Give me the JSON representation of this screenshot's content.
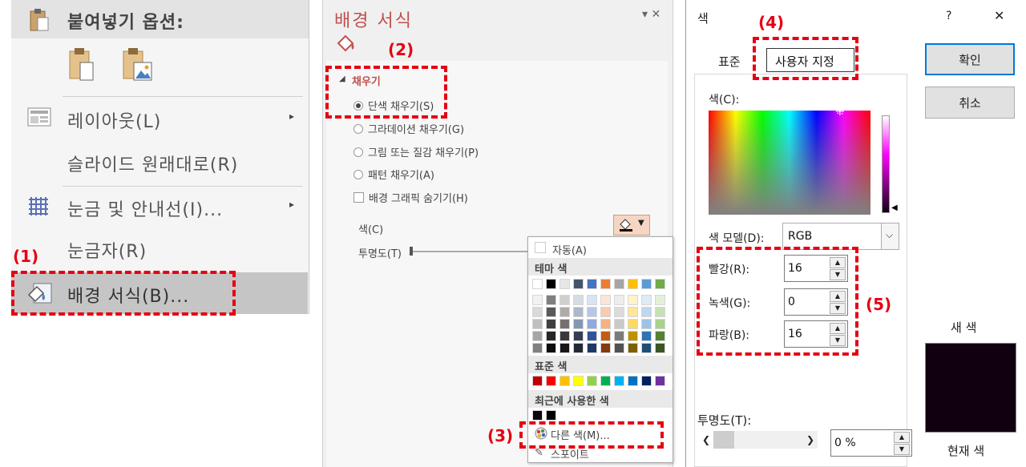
{
  "menu": {
    "paste_header": "붙여넣기 옵션:",
    "items": [
      {
        "label": "레이아웃(L)",
        "submenu": true
      },
      {
        "label": "슬라이드 원래대로(R)",
        "submenu": false
      },
      {
        "label": "눈금 및 안내선(I)...",
        "submenu": true
      },
      {
        "label": "눈금자(R)",
        "submenu": false
      },
      {
        "label": "배경 서식(B)...",
        "submenu": false
      }
    ],
    "submenu_arrow": "▸"
  },
  "pane": {
    "title": "배경 서식",
    "header_ctrl": "▾ ✕",
    "section": "채우기",
    "options": [
      {
        "label": "단색 채우기(S)",
        "checked": true
      },
      {
        "label": "그라데이션 채우기(G)",
        "checked": false
      },
      {
        "label": "그림 또는 질감 채우기(P)",
        "checked": false
      },
      {
        "label": "패턴 채우기(A)",
        "checked": false
      }
    ],
    "hide_graphics": "배경 그래픽 숨기기(H)",
    "color_label": "색(C)",
    "transparency_label": "투명도(T)"
  },
  "color_menu": {
    "auto": "자동(A)",
    "theme_title": "테마 색",
    "standard_title": "표준 색",
    "recent_title": "최근에 사용한 색",
    "more_colors": "다른 색(M)...",
    "eyedropper": "스포이트",
    "theme_top": [
      "#ffffff",
      "#000000",
      "#e7e6e6",
      "#44546a",
      "#4472c4",
      "#ed7d31",
      "#a5a5a5",
      "#ffc000",
      "#5b9bd5",
      "#70ad47"
    ],
    "theme_cols": [
      [
        "#f2f2f2",
        "#d9d9d9",
        "#bfbfbf",
        "#a6a6a6",
        "#808080"
      ],
      [
        "#808080",
        "#595959",
        "#404040",
        "#262626",
        "#0d0d0d"
      ],
      [
        "#d0cece",
        "#aeabab",
        "#757171",
        "#3a3838",
        "#171717"
      ],
      [
        "#d6dce5",
        "#adb9ca",
        "#8497b0",
        "#333f50",
        "#222a35"
      ],
      [
        "#dae3f3",
        "#b4c7e7",
        "#8faadc",
        "#2f5597",
        "#1f3864"
      ],
      [
        "#fbe5d6",
        "#f8cbad",
        "#f4b183",
        "#c55a11",
        "#843c0c"
      ],
      [
        "#ededed",
        "#dbdbdb",
        "#c9c9c9",
        "#7b7b7b",
        "#525252"
      ],
      [
        "#fff2cc",
        "#ffe699",
        "#ffd966",
        "#bf9000",
        "#7f6000"
      ],
      [
        "#deebf7",
        "#bdd7ee",
        "#9dc3e6",
        "#2e75b6",
        "#1f4e79"
      ],
      [
        "#e2f0d9",
        "#c5e0b4",
        "#a9d18e",
        "#548235",
        "#385723"
      ]
    ],
    "standard": [
      "#c00000",
      "#ff0000",
      "#ffc000",
      "#ffff00",
      "#92d050",
      "#00b050",
      "#00b0f0",
      "#0070c0",
      "#002060",
      "#7030a0"
    ],
    "recent": [
      "#100010",
      "#000000"
    ]
  },
  "dialog": {
    "title": "색",
    "help": "?",
    "close": "✕",
    "tab_standard": "표준",
    "tab_custom": "사용자 지정",
    "ok": "확인",
    "cancel": "취소",
    "color_label": "색(C):",
    "model_label": "색 모델(D):",
    "model_value": "RGB",
    "red_label": "빨강(R):",
    "green_label": "녹색(G):",
    "blue_label": "파랑(B):",
    "red": "16",
    "green": "0",
    "blue": "16",
    "transparency_label": "투명도(T):",
    "transparency_value": "0 %",
    "new_label": "새 색",
    "current_label": "현재 색",
    "new_color": "#100010"
  },
  "callouts": [
    "(1)",
    "(2)",
    "(3)",
    "(4)",
    "(5)"
  ]
}
